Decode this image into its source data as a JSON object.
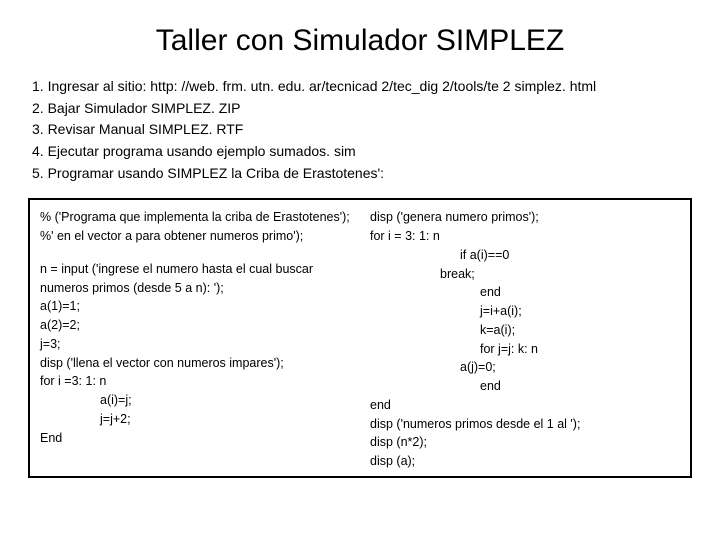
{
  "title": "Taller con Simulador SIMPLEZ",
  "steps": {
    "s1": "1. Ingresar al sitio: http: //web. frm. utn. edu. ar/tecnicad 2/tec_dig 2/tools/te 2 simplez. html",
    "s2": "2. Bajar Simulador SIMPLEZ. ZIP",
    "s3": "3. Revisar Manual SIMPLEZ. RTF",
    "s4": "4. Ejecutar programa usando ejemplo sumados. sim",
    "s5": "5. Programar usando SIMPLEZ la Criba de Erastotenes':"
  },
  "left": {
    "l1": "% ('Programa que implementa la criba de Erastotenes');",
    "l2": "%' en el vector a para obtener numeros primo');",
    "l3": "n = input ('ingrese el numero hasta el cual buscar numeros primos (desde 5 a n): ');",
    "l4": "a(1)=1;",
    "l5": "a(2)=2;",
    "l6": "j=3;",
    "l7": "disp ('llena el vector con numeros impares');",
    "l8": "for i =3: 1: n",
    "l9": "a(i)=j;",
    "l10": "j=j+2;",
    "l11": "End"
  },
  "right": {
    "r1": "disp ('genera numero primos');",
    "r2": "for i = 3: 1: n",
    "r3": "if a(i)==0",
    "r4": "break;",
    "r5": "end",
    "r6": "j=i+a(i);",
    "r7": "k=a(i);",
    "r8": "for j=j: k: n",
    "r9": "a(j)=0;",
    "r10": "end",
    "r11": "end",
    "r12": "disp ('numeros primos desde el 1 al ');",
    "r13": "disp (n*2);",
    "r14": "disp (a);"
  }
}
